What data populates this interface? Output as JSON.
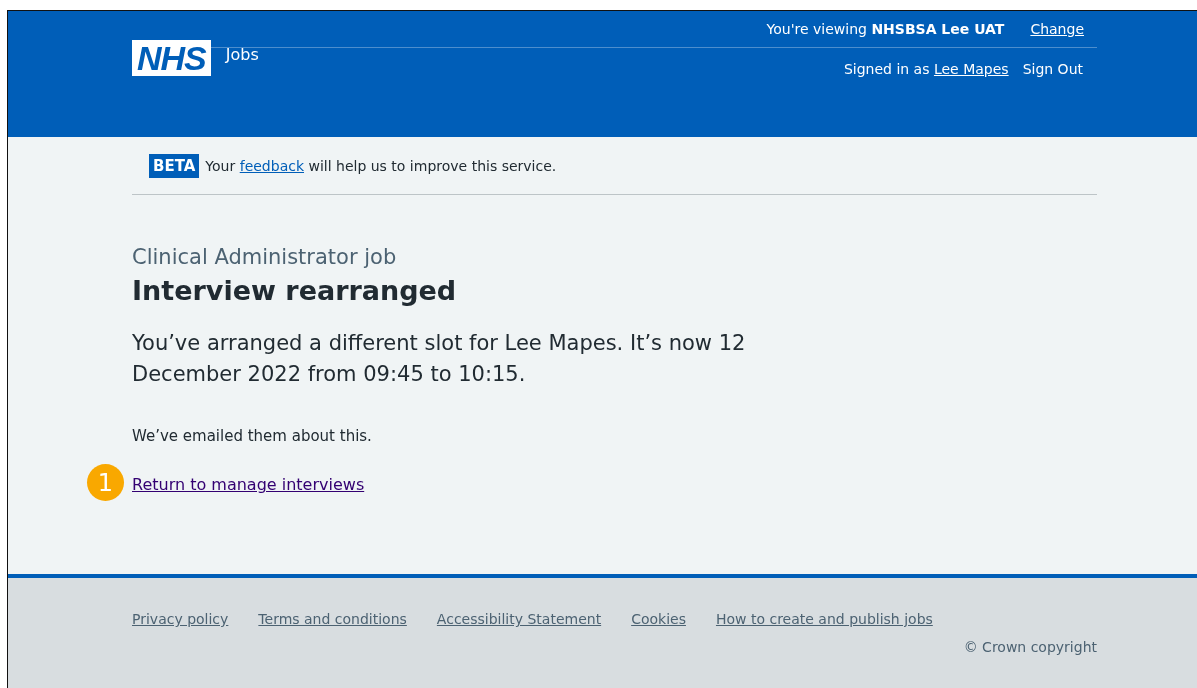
{
  "header": {
    "logo": "NHS",
    "service": "Jobs",
    "viewing": "You're viewing **NHSBSA Lee UAT**",
    "change_link": "Change",
    "signed_in": "Signed in as",
    "user_link": "Lee Mapes",
    "sign_out": "Sign Out"
  },
  "phase_banner": {
    "tag": "BETA",
    "before": "Your",
    "link": "feedback",
    "after": "will help us to improve this service."
  },
  "main": {
    "caption": "Clinical Administrator job",
    "heading": "Interview rearranged",
    "lead": "You’ve arranged a different slot for Lee Mapes. It’s now 12 December 2022 from 09:45 to 10:15.",
    "body": "We’ve emailed them about this.",
    "callout": "1",
    "link": "Return to manage interviews"
  },
  "footer": {
    "links": [
      "Privacy policy",
      "Terms and conditions",
      "Accessibility Statement",
      "Cookies",
      "How to create and publish jobs"
    ],
    "copyright": "© Crown copyright"
  }
}
